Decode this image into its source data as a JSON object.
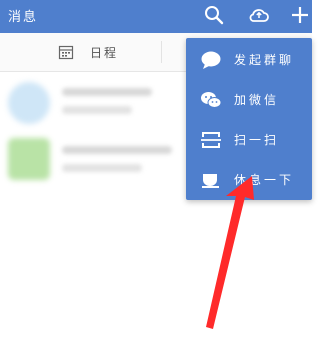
{
  "header": {
    "title": "消息",
    "icons": [
      "search-icon",
      "cloud-icon",
      "plus-icon"
    ],
    "background": "#4f7fcd"
  },
  "tabs": {
    "schedule_label": "日程"
  },
  "menu": {
    "items": [
      {
        "label": "发起群聊",
        "icon": "chat-bubble-icon"
      },
      {
        "label": "加微信",
        "icon": "wechat-icon"
      },
      {
        "label": "扫一扫",
        "icon": "scan-icon"
      },
      {
        "label": "休息一下",
        "icon": "cup-icon"
      }
    ]
  },
  "annotation": {
    "arrow_color": "#ff2a2a"
  }
}
